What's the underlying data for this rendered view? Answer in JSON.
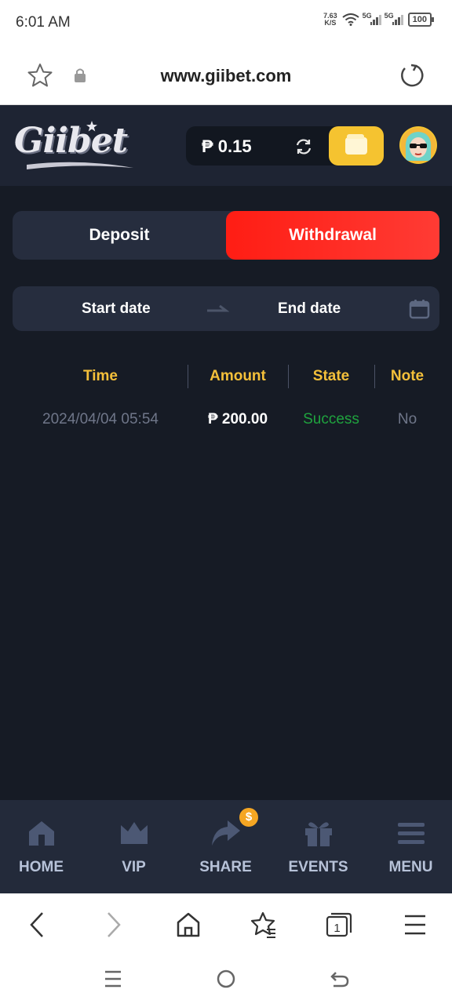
{
  "status_bar": {
    "time": "6:01 AM",
    "net_speed_value": "7.63",
    "net_speed_unit": "K/S",
    "signal1_label": "5G",
    "signal2_label": "5G",
    "battery": "100"
  },
  "browser": {
    "url": "www.giibet.com",
    "icons": [
      "star-icon",
      "lock-icon",
      "reload-icon",
      "back-icon",
      "forward-icon",
      "home-icon",
      "bookmarks-icon",
      "tabs-icon",
      "menu-icon"
    ],
    "tab_count": "1"
  },
  "site": {
    "logo_text": "Giibet",
    "balance": "₱ 0.15"
  },
  "tabs": {
    "deposit_label": "Deposit",
    "withdrawal_label": "Withdrawal",
    "active": "Withdrawal"
  },
  "date_range": {
    "start_label": "Start date",
    "end_label": "End date"
  },
  "table": {
    "headers": [
      "Time",
      "Amount",
      "State",
      "Note"
    ],
    "rows": [
      {
        "time": "2024/04/04 05:54",
        "amount": "₱ 200.00",
        "state": "Success",
        "note": "No"
      }
    ]
  },
  "bottom_nav": {
    "items": [
      {
        "label": "HOME",
        "icon": "home-icon"
      },
      {
        "label": "VIP",
        "icon": "crown-icon"
      },
      {
        "label": "SHARE",
        "icon": "share-icon"
      },
      {
        "label": "EVENTS",
        "icon": "gift-icon"
      },
      {
        "label": "MENU",
        "icon": "hamburger-icon"
      }
    ],
    "coin_symbol": "$"
  },
  "colors": {
    "accent_red": "#ff1d14",
    "accent_gold": "#f4c03a",
    "success_green": "#1fa33e",
    "background": "#161b25"
  }
}
